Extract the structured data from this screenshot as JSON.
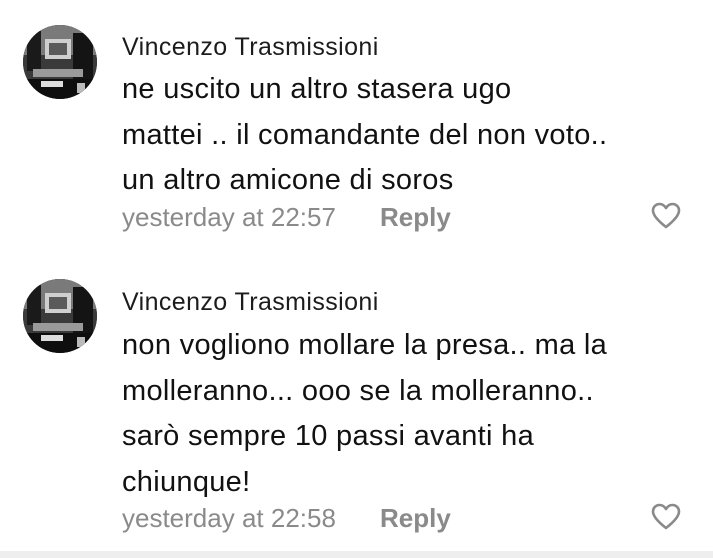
{
  "comments": [
    {
      "author": "Vincenzo Trasmissioni",
      "lines": [
        "ne uscito un altro stasera ugo",
        "mattei .. il comandante del non voto..",
        "un altro amicone di soros"
      ],
      "timestamp": "yesterday at 22:57",
      "reply_label": "Reply",
      "like_icon": "heart-outline-icon"
    },
    {
      "author": "Vincenzo Trasmissioni",
      "lines": [
        "non vogliono mollare la presa.. ma la",
        "molleranno... ooo se la molleranno..",
        "sarò sempre 10 passi avanti ha",
        "chiunque!"
      ],
      "timestamp": "yesterday at 22:58",
      "reply_label": "Reply",
      "like_icon": "heart-outline-icon"
    }
  ],
  "colors": {
    "text": "#111111",
    "meta": "#8a8a8a",
    "background": "#ffffff"
  }
}
